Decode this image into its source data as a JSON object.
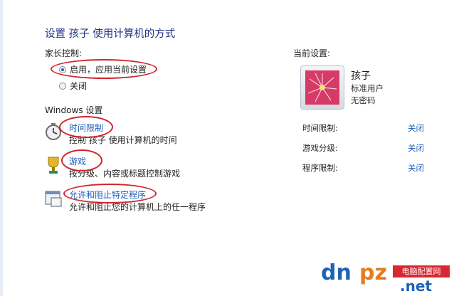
{
  "header": {
    "title": "设置 孩子 使用计算机的方式"
  },
  "parental_controls": {
    "heading": "家长控制:",
    "options": [
      {
        "label": "启用，应用当前设置",
        "checked": true
      },
      {
        "label": "关闭",
        "checked": false
      }
    ]
  },
  "windows_settings": {
    "heading": "Windows 设置",
    "items": [
      {
        "icon": "clock-icon",
        "title": "时间限制",
        "desc": "控制 孩子 使用计算机的时间"
      },
      {
        "icon": "game-trophy-icon",
        "title": "游戏",
        "desc": "按分级、内容或标题控制游戏"
      },
      {
        "icon": "program-window-icon",
        "title": "允许和阻止特定程序",
        "desc": "允许和阻止您的计算机上的任一程序"
      }
    ]
  },
  "current_settings": {
    "heading": "当前设置:",
    "user": {
      "name": "孩子",
      "type": "标准用户",
      "password": "无密码"
    },
    "rows": [
      {
        "label": "时间限制:",
        "value": "关闭"
      },
      {
        "label": "游戏分级:",
        "value": "关闭"
      },
      {
        "label": "程序限制:",
        "value": "关闭"
      }
    ]
  },
  "watermark": {
    "part1": "dn",
    "part2": "pz",
    "suffix": ".net",
    "banner": "电脑配置网"
  },
  "colors": {
    "link": "#1c5eb8",
    "title": "#1e3287",
    "annotation": "#d0242e"
  }
}
